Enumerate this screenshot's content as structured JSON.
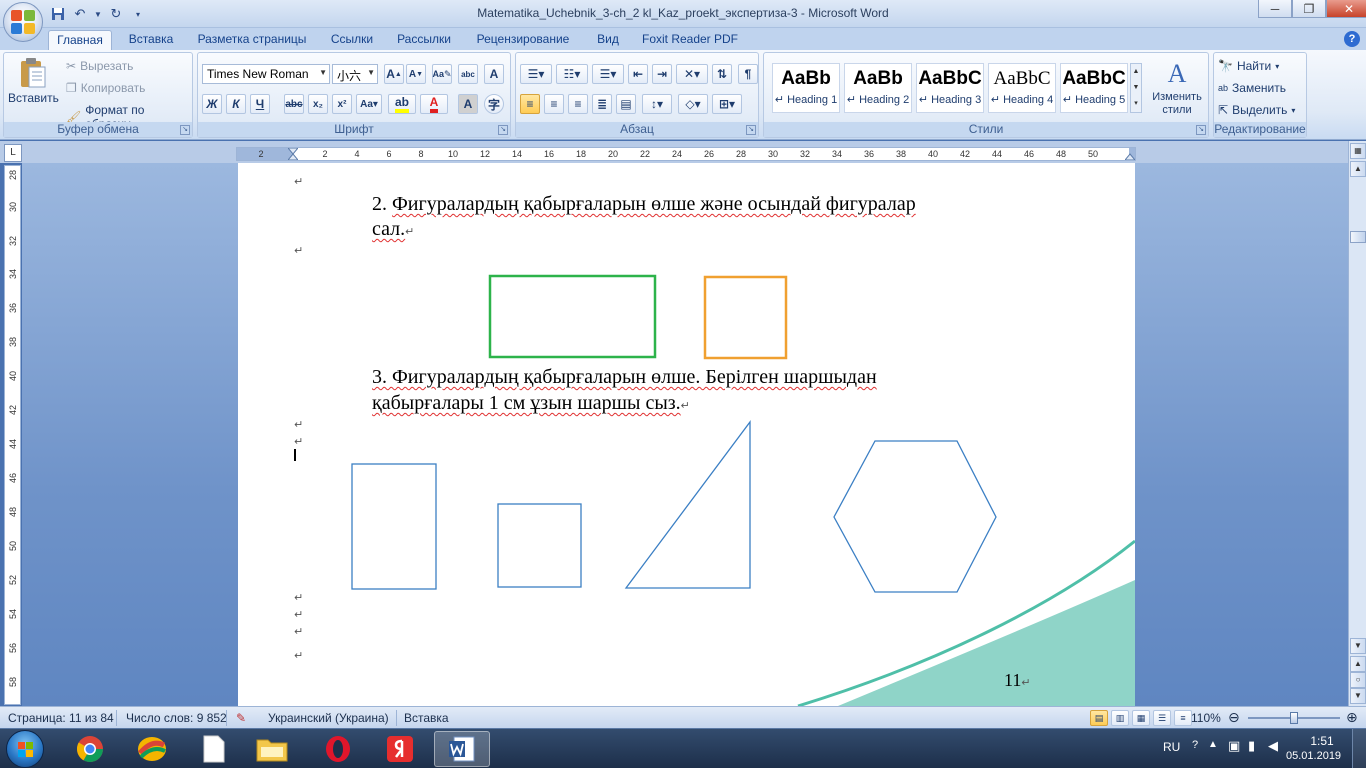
{
  "titlebar": {
    "title": "Matematika_Uchebnik_3-ch_2 kl_Kaz_proekt_экспертиза-3 - Microsoft Word"
  },
  "tabs": [
    "Главная",
    "Вставка",
    "Разметка страницы",
    "Ссылки",
    "Рассылки",
    "Рецензирование",
    "Вид",
    "Foxit Reader PDF"
  ],
  "clipboard": {
    "label": "Буфер обмена",
    "paste": "Вставить",
    "cut": "Вырезать",
    "copy": "Копировать",
    "format_painter": "Формат по образцу"
  },
  "font": {
    "label": "Шрифт",
    "family": "Times New Roman",
    "size": "小六"
  },
  "paragraph": {
    "label": "Абзац"
  },
  "styles": {
    "label": "Стили",
    "items": [
      {
        "sample": "AaBb",
        "name": "Heading 1"
      },
      {
        "sample": "AaBb",
        "name": "Heading 2"
      },
      {
        "sample": "AaBbC",
        "name": "Heading 3"
      },
      {
        "sample": "AaBbC",
        "name": "Heading 4"
      },
      {
        "sample": "AaBbC",
        "name": "Heading 5"
      }
    ],
    "change": "Изменить стили"
  },
  "editing": {
    "label": "Редактирование",
    "find": "Найти",
    "replace": "Заменить",
    "select": "Выделить"
  },
  "ruler": {
    "ticks": [
      "2",
      "2",
      "4",
      "6",
      "8",
      "10",
      "12",
      "14",
      "16",
      "18",
      "20",
      "22",
      "24",
      "26",
      "28",
      "30",
      "32",
      "34",
      "36",
      "38",
      "40",
      "42",
      "44",
      "46",
      "48",
      "50"
    ],
    "vticks": [
      "28",
      "30",
      "32",
      "34",
      "36",
      "38",
      "40",
      "42",
      "44",
      "46",
      "48",
      "50",
      "52",
      "54",
      "56",
      "58"
    ]
  },
  "document": {
    "task2": {
      "number": "2.",
      "line1": "Фигуралардың қабырғаларын өлше және осындай фигуралар",
      "line2": "сал."
    },
    "task3": {
      "line1": "3. Фигуралардың қабырғаларын өлше. Берілген шаршыдан",
      "line2": "қабырғалары 1 см ұзын шаршы сыз."
    },
    "page_number": "11",
    "colors": {
      "green_rect": "#2db34a",
      "orange_square": "#f0a030",
      "shape_stroke": "#3b7fc4",
      "decor_teal": "#4fbfa8"
    }
  },
  "statusbar": {
    "page": "Страница: 11 из 84",
    "words": "Число слов: 9 852",
    "language": "Украинский (Украина)",
    "mode": "Вставка",
    "zoom": "110%"
  },
  "taskbar": {
    "lang": "RU",
    "time": "1:51",
    "date": "05.01.2019"
  }
}
